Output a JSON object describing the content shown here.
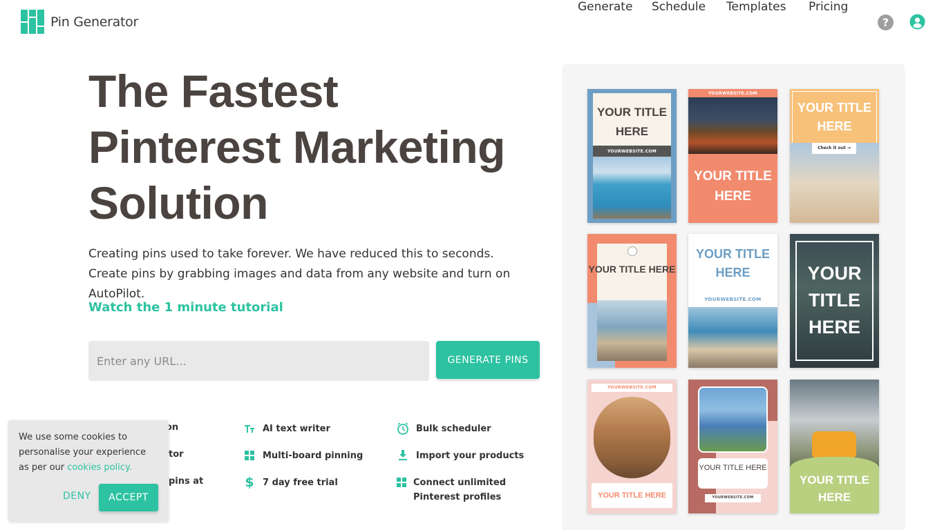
{
  "brand": {
    "name": "Pin Generator",
    "accent": "#2dc2a1"
  },
  "nav": {
    "items": [
      "Generate",
      "Schedule",
      "Templates",
      "Pricing"
    ]
  },
  "hero": {
    "title_line1": "The Fastest",
    "title_line2": "Pinterest Marketing",
    "title_line3": "Solution",
    "subtitle": "Creating pins used to take forever. We have reduced this to seconds. Create pins by grabbing images and data from any website and turn on AutoPilot.",
    "tutorial_link": "Watch the 1 minute tutorial",
    "url_placeholder": "Enter any URL...",
    "generate_button": "GENERATE PINS"
  },
  "features": [
    {
      "icon": "text-size-icon",
      "label": "AI text writer"
    },
    {
      "icon": "grid-icon",
      "label": "Multi-board pinning"
    },
    {
      "icon": "dollar-icon",
      "label": "7 day free trial"
    },
    {
      "icon": "alarm-clock-icon",
      "label": "Bulk scheduler"
    },
    {
      "icon": "download-icon",
      "label": "Import your products"
    },
    {
      "icon": "grid-icon",
      "label": "Connect unlimited Pinterest profiles"
    }
  ],
  "partial_features": [
    "on",
    "tor",
    "pins at"
  ],
  "templates": {
    "pin1_title": "YOUR TITLE HERE",
    "pin1_web": "YOURWEBSITE.COM",
    "pin2_web": "YOURWEBSITE.COM",
    "pin2_title": "YOUR TITLE HERE",
    "pin3_title": "YOUR TITLE HERE",
    "pin3_cta": "Check it out →",
    "pin4_title": "YOUR TITLE HERE",
    "pin5_title": "YOUR TITLE HERE",
    "pin5_web": "YOURWEBSITE.COM",
    "pin6_title": "YOUR TITLE HERE",
    "pin7_web": "YOURWEBSITE.COM",
    "pin7_title": "YOUR TITLE HERE",
    "pin8_title": "YOUR TITLE HERE",
    "pin8_web": "YOURWEBSITE.COM",
    "pin9_title": "YOUR TITLE HERE"
  },
  "cookie": {
    "text": "We use some cookies to personalise your experience as per our",
    "policy_link": "cookies policy.",
    "deny": "DENY",
    "accept": "ACCEPT"
  }
}
